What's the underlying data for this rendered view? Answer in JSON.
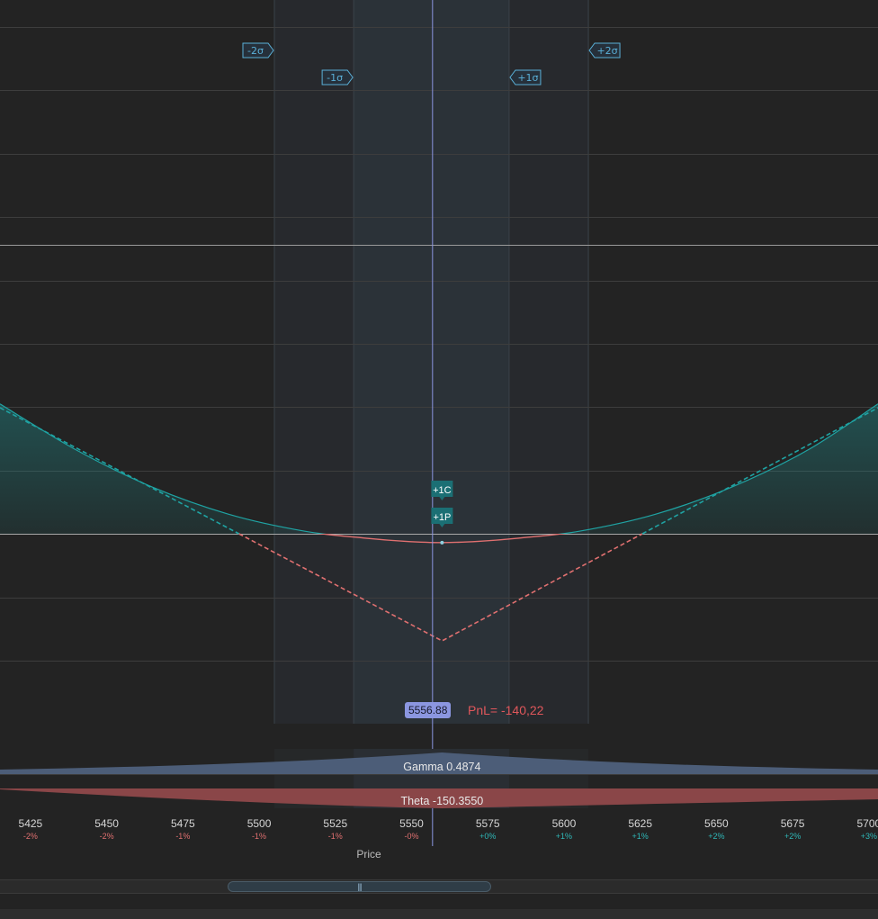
{
  "chart_data": {
    "type": "line",
    "xlabel": "Price",
    "xlim": [
      5415,
      5703
    ],
    "x_ticks": [
      {
        "value": 5425,
        "label": "5425",
        "pct": "-2%"
      },
      {
        "value": 5450,
        "label": "5450",
        "pct": "-2%"
      },
      {
        "value": 5475,
        "label": "5475",
        "pct": "-1%"
      },
      {
        "value": 5500,
        "label": "5500",
        "pct": "-1%"
      },
      {
        "value": 5525,
        "label": "5525",
        "pct": "-1%"
      },
      {
        "value": 5550,
        "label": "5550",
        "pct": "-0%"
      },
      {
        "value": 5575,
        "label": "5575",
        "pct": "+0%"
      },
      {
        "value": 5600,
        "label": "5600",
        "pct": "+1%"
      },
      {
        "value": 5625,
        "label": "5625",
        "pct": "+1%"
      },
      {
        "value": 5650,
        "label": "5650",
        "pct": "+2%"
      },
      {
        "value": 5675,
        "label": "5675",
        "pct": "+2%"
      },
      {
        "value": 5700,
        "label": "5700",
        "pct": "+3%"
      }
    ],
    "current_price": 5556.88,
    "current_price_label": "5556.88",
    "strike": 5560,
    "pnl_text": "PnL= -140,22",
    "pnl_at_current": -140.22,
    "ylim": [
      -2000,
      8000
    ],
    "sigma_bands": [
      {
        "label": "-2σ",
        "value": 5505
      },
      {
        "label": "-1σ",
        "value": 5531
      },
      {
        "label": "+1σ",
        "value": 5582
      },
      {
        "label": "+2σ",
        "value": 5608
      }
    ],
    "legs": [
      {
        "label": "+1C"
      },
      {
        "label": "+1P"
      }
    ],
    "series": [
      {
        "kind": "today",
        "x": [
          5415,
          5440,
          5465,
          5490,
          5515,
          5535,
          5548,
          5560,
          5572,
          5585,
          5605,
          5630,
          5655,
          5680,
          5703
        ],
        "y": [
          2060,
          1330,
          740,
          310,
          40,
          -70,
          -120,
          -140,
          -120,
          -70,
          40,
          310,
          740,
          1330,
          2060
        ]
      },
      {
        "kind": "expiration",
        "x": [
          5415,
          5560,
          5703
        ],
        "y": [
          2000,
          -1700,
          2000
        ]
      }
    ],
    "gamma_text": "Gamma 0.4874",
    "theta_text": "Theta -150.3550",
    "colors": {
      "profit": "#1fa3a3",
      "loss": "#e07070",
      "sigma": "#5ab0d8",
      "current": "#8b96e0",
      "gamma_fill": "#4c5d78",
      "theta_fill": "#8a4648"
    }
  }
}
